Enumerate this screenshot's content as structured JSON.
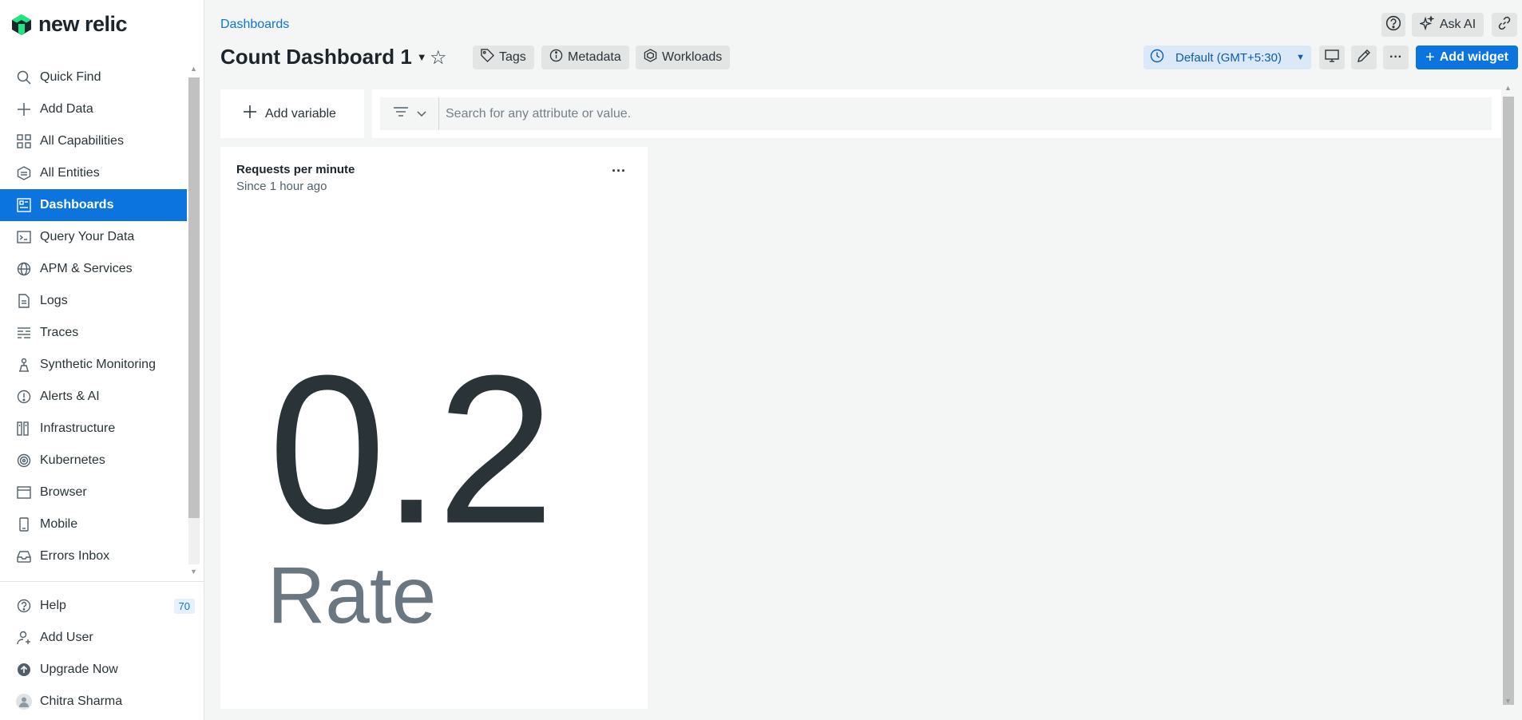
{
  "brand": {
    "logo_text": "new relic",
    "accent": "#0c74df",
    "logo_color": "#1ce783"
  },
  "sidebar": {
    "items": [
      {
        "label": "Quick Find",
        "icon": "search-icon"
      },
      {
        "label": "Add Data",
        "icon": "plus-icon"
      },
      {
        "label": "All Capabilities",
        "icon": "grid-icon"
      },
      {
        "label": "All Entities",
        "icon": "hexagon-icon"
      },
      {
        "label": "Dashboards",
        "icon": "dashboard-icon",
        "active": true
      },
      {
        "label": "Query Your Data",
        "icon": "terminal-icon"
      },
      {
        "label": "APM & Services",
        "icon": "globe-icon"
      },
      {
        "label": "Logs",
        "icon": "document-icon"
      },
      {
        "label": "Traces",
        "icon": "traces-icon"
      },
      {
        "label": "Synthetic Monitoring",
        "icon": "robot-icon"
      },
      {
        "label": "Alerts & AI",
        "icon": "alert-icon"
      },
      {
        "label": "Infrastructure",
        "icon": "infrastructure-icon"
      },
      {
        "label": "Kubernetes",
        "icon": "kubernetes-icon"
      },
      {
        "label": "Browser",
        "icon": "browser-icon"
      },
      {
        "label": "Mobile",
        "icon": "mobile-icon"
      },
      {
        "label": "Errors Inbox",
        "icon": "inbox-icon"
      }
    ],
    "bottom": {
      "help_label": "Help",
      "help_badge": "70",
      "add_user_label": "Add User",
      "upgrade_label": "Upgrade Now",
      "user_name": "Chitra Sharma"
    }
  },
  "header": {
    "breadcrumb": "Dashboards",
    "title": "Count Dashboard 1",
    "tags_label": "Tags",
    "metadata_label": "Metadata",
    "workloads_label": "Workloads",
    "ask_ai_label": "Ask AI",
    "timezone_label": "Default (GMT+5:30)",
    "add_widget_label": "Add widget"
  },
  "filters": {
    "add_variable_label": "Add variable",
    "search_placeholder": "Search for any attribute or value."
  },
  "widget": {
    "title": "Requests per minute",
    "subtitle": "Since 1 hour ago",
    "menu_label": "...",
    "value": "0.2",
    "value_label": "Rate"
  }
}
